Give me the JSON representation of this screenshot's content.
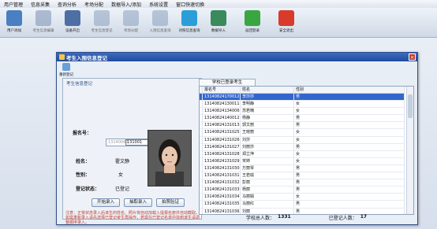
{
  "menu": [
    "用户管理",
    "信息采集",
    "查询分析",
    "考场分配",
    "数据导入/添加",
    "系统设置",
    "窗口快速切换"
  ],
  "toolbar": [
    {
      "label": "用户添加",
      "icon": "users-icon",
      "dim": false
    },
    {
      "label": "考生信息编辑",
      "icon": "edit-icon",
      "dim": true
    },
    {
      "label": "设备开启",
      "icon": "camera-icon",
      "dim": false
    },
    {
      "label": "考生信息登记",
      "icon": "register-icon",
      "dim": true
    },
    {
      "label": "考场分配",
      "icon": "room-icon",
      "dim": true
    },
    {
      "label": "入围信息查询",
      "icon": "search-list-icon",
      "dim": true
    },
    {
      "label": "对照信息查询",
      "icon": "magnifier-icon",
      "dim": false
    },
    {
      "label": "数据导入",
      "icon": "import-icon",
      "dim": false
    },
    {
      "label": "返回登录",
      "icon": "back-arrow-icon",
      "dim": false
    },
    {
      "label": "安全退出",
      "icon": "power-icon",
      "dim": false
    }
  ],
  "dialog": {
    "title": "考生入围信息登记",
    "tool_label": "重新登记",
    "panel_title": "考生信息登记",
    "exam_no_label": "报名号：",
    "exam_no_placeholder": "13140082",
    "exam_no_value": "131001",
    "name_label": "姓名：",
    "name_value": "霍文静",
    "gender_label": "性别：",
    "gender_value": "女",
    "status_label": "登记状态：",
    "status_value": "已登记",
    "btn_start": "开始录入",
    "btn_manual": "抽取录入",
    "btn_compare": "拍照验证",
    "note": "注意：正常状态录入后该生的姓名、照片将自动加载入提报名册并自动截取。如需重新录入请先选择已登记考生再操作，若需在已登记名单中找到该生请调整顺序录入。",
    "tab_label": "学校已登录考生",
    "columns": [
      "报名号",
      "姓名",
      "性别"
    ],
    "rows": [
      [
        "13140824170012",
        "李莎莎",
        "男"
      ],
      [
        "13140824130011",
        "李明静",
        "女"
      ],
      [
        "13140824134006",
        "苏若楠",
        "女"
      ],
      [
        "13140824140012",
        "杨静",
        "男"
      ],
      [
        "13140824131013",
        "郭文丽",
        "男"
      ],
      [
        "13140824131025",
        "王晓丽",
        "女"
      ],
      [
        "13140824131026",
        "刘莎",
        "女"
      ],
      [
        "13140824131027",
        "刘丽莎",
        "男"
      ],
      [
        "13140824131028",
        "郑立萍",
        "女"
      ],
      [
        "13140824131029",
        "宋婷",
        "女"
      ],
      [
        "13140824131030",
        "万丽琴",
        "男"
      ],
      [
        "13140824131031",
        "王若瑜",
        "男"
      ],
      [
        "13140824131032",
        "彭丽",
        "男"
      ],
      [
        "13140824131033",
        "杨丽",
        "男"
      ],
      [
        "13140824131034",
        "马丽娟",
        "女"
      ],
      [
        "13140824131035",
        "马丽红",
        "男"
      ],
      [
        "13140824131036",
        "刘丽",
        "男"
      ],
      [
        "13140824131037",
        "杨若楠",
        "女"
      ]
    ],
    "selected_index": 0,
    "total_label": "学校总人数：",
    "total_value": "1331",
    "registered_label": "已登记人数：",
    "registered_value": "17"
  }
}
